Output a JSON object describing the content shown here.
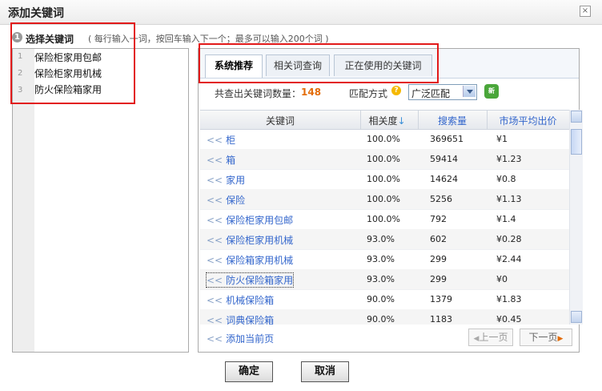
{
  "dialog": {
    "title": "添加关键词",
    "close_glyph": "×"
  },
  "step": {
    "number": "1",
    "label": "选择关键词",
    "hint": "( 每行输入一词，按回车输入下一个；最多可以输入200个词 )"
  },
  "input_list": [
    {
      "num": "1",
      "text": "保险柜家用包邮"
    },
    {
      "num": "2",
      "text": "保险柜家用机械"
    },
    {
      "num": "3",
      "text": "防火保险箱家用"
    }
  ],
  "tabs": [
    {
      "label": "系统推荐"
    },
    {
      "label": "相关词查询"
    },
    {
      "label": "正在使用的关键词"
    }
  ],
  "summary": {
    "count_label": "共查出关键词数量：",
    "count_value": "148"
  },
  "match": {
    "label": "匹配方式",
    "help_icon": "?",
    "selected": "广泛匹配",
    "new_badge": "新"
  },
  "table": {
    "headers": [
      "关键词",
      "相关度",
      "搜索量",
      "市场平均出价"
    ],
    "sort_icon": "↓",
    "rows": [
      {
        "kw": "柜",
        "rel": "100.0%",
        "search": "369651",
        "price": "¥1"
      },
      {
        "kw": "箱",
        "rel": "100.0%",
        "search": "59414",
        "price": "¥1.23"
      },
      {
        "kw": "家用",
        "rel": "100.0%",
        "search": "14624",
        "price": "¥0.8"
      },
      {
        "kw": "保险",
        "rel": "100.0%",
        "search": "5256",
        "price": "¥1.13"
      },
      {
        "kw": "保险柜家用包邮",
        "rel": "100.0%",
        "search": "792",
        "price": "¥1.4"
      },
      {
        "kw": "保险柜家用机械",
        "rel": "93.0%",
        "search": "602",
        "price": "¥0.28"
      },
      {
        "kw": "保险箱家用机械",
        "rel": "93.0%",
        "search": "299",
        "price": "¥2.44"
      },
      {
        "kw": "防火保险箱家用",
        "rel": "93.0%",
        "search": "299",
        "price": "¥0"
      },
      {
        "kw": "机械保险箱",
        "rel": "90.0%",
        "search": "1379",
        "price": "¥1.83"
      },
      {
        "kw": "词典保险箱",
        "rel": "90.0%",
        "search": "1183",
        "price": "¥0.45"
      }
    ]
  },
  "footer": {
    "add_page": "添加当前页",
    "prev": "上一页",
    "next": "下一页",
    "arrow_glyph": "<<",
    "prev_glyph": "◀",
    "next_glyph": "▶"
  },
  "buttons": {
    "ok": "确定",
    "cancel": "取消"
  },
  "colors": {
    "highlight_box": "#e21a1a",
    "count": "#e36c09",
    "link": "#3366cc"
  }
}
